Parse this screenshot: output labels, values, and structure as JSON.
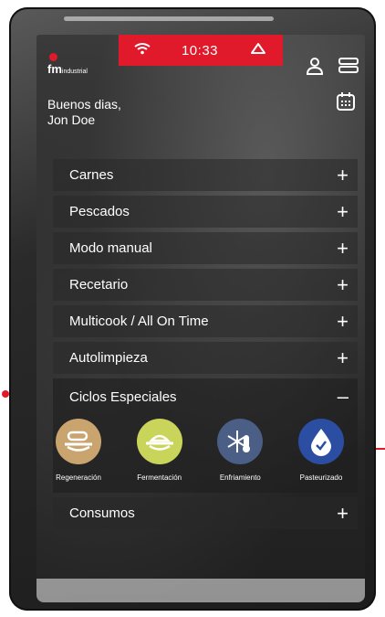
{
  "status": {
    "time": "10:33"
  },
  "brand": {
    "logo_text": "fm",
    "logo_sub": "industrial"
  },
  "greeting": {
    "line1": "Buenos dias,",
    "line2": "Jon Doe"
  },
  "menu": {
    "items": [
      {
        "label": "Carnes",
        "toggle": "+"
      },
      {
        "label": "Pescados",
        "toggle": "+"
      },
      {
        "label": "Modo manual",
        "toggle": "+"
      },
      {
        "label": "Recetario",
        "toggle": "+"
      },
      {
        "label": "Multicook / All On Time",
        "toggle": "+"
      },
      {
        "label": "Autolimpieza",
        "toggle": "+"
      }
    ],
    "special": {
      "label": "Ciclos Especiales",
      "toggle": "–",
      "cycles": [
        {
          "label": "Regeneración",
          "color": "#c9a46e",
          "icon": "plate-cloche-icon"
        },
        {
          "label": "Fermentación",
          "color": "#c8d45a",
          "icon": "dough-bowl-icon"
        },
        {
          "label": "Enfriamiento",
          "color": "#4a5e86",
          "icon": "snowflake-thermometer-icon"
        },
        {
          "label": "Pasteurizado",
          "color": "#2b4ea3",
          "icon": "drop-check-icon"
        }
      ]
    },
    "last": {
      "label": "Consumos",
      "toggle": "+"
    }
  },
  "colors": {
    "accent": "#e0192b"
  }
}
